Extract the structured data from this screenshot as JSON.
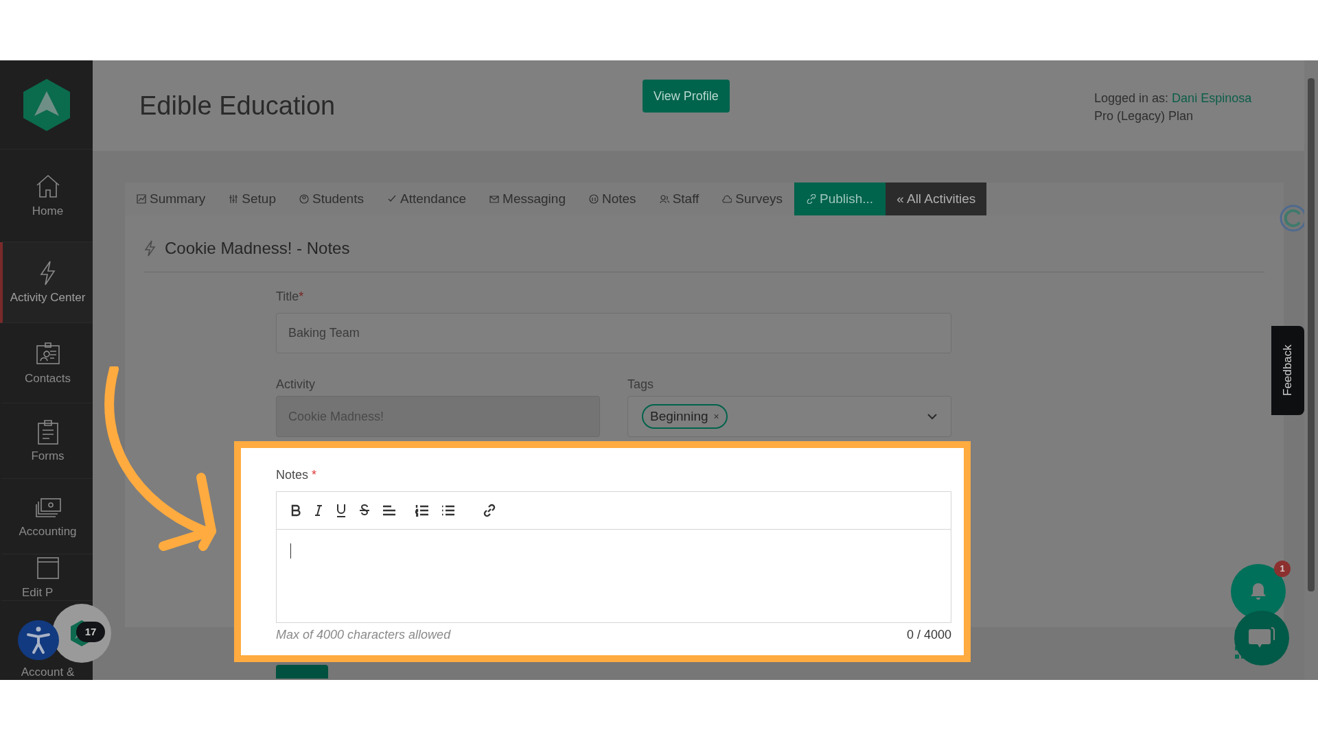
{
  "sidebar": {
    "items": [
      {
        "label": "Home",
        "selected": false
      },
      {
        "label": "Activity Center",
        "selected": true
      },
      {
        "label": "Contacts",
        "selected": false
      },
      {
        "label": "Forms",
        "selected": false
      },
      {
        "label": "Accounting",
        "selected": false
      },
      {
        "label": "Edit P",
        "selected": false
      },
      {
        "label": "Account &",
        "selected": false
      }
    ],
    "badge": "17"
  },
  "header": {
    "title": "Edible Education",
    "button": "View Profile",
    "logged_in_label": "Logged in as:",
    "user": "Dani Espinosa",
    "plan": "Pro (Legacy) Plan"
  },
  "tabs": [
    {
      "label": "Summary",
      "kind": "tab"
    },
    {
      "label": "Setup",
      "kind": "tab"
    },
    {
      "label": "Students",
      "kind": "tab"
    },
    {
      "label": "Attendance",
      "kind": "tab"
    },
    {
      "label": "Messaging",
      "kind": "tab"
    },
    {
      "label": "Notes",
      "kind": "tab"
    },
    {
      "label": "Staff",
      "kind": "tab"
    },
    {
      "label": "Surveys",
      "kind": "tab"
    },
    {
      "label": "Publish...",
      "kind": "publish"
    },
    {
      "label": "« All Activities",
      "kind": "back"
    }
  ],
  "section": {
    "title": "Cookie Madness! - Notes"
  },
  "form": {
    "title": {
      "label": "Title",
      "required_mark": "*",
      "value": "Baking Team"
    },
    "activity": {
      "label": "Activity",
      "value": "Cookie Madness!",
      "disabled": true
    },
    "tags": {
      "label": "Tags",
      "values": [
        "Beginning"
      ],
      "remove": "×"
    },
    "notes": {
      "label": "Notes",
      "required_mark": "*",
      "hint": "Max of 4000 characters allowed",
      "count": "0 / 4000"
    }
  },
  "feedback": "Feedback",
  "notifications": {
    "badge": "1"
  }
}
